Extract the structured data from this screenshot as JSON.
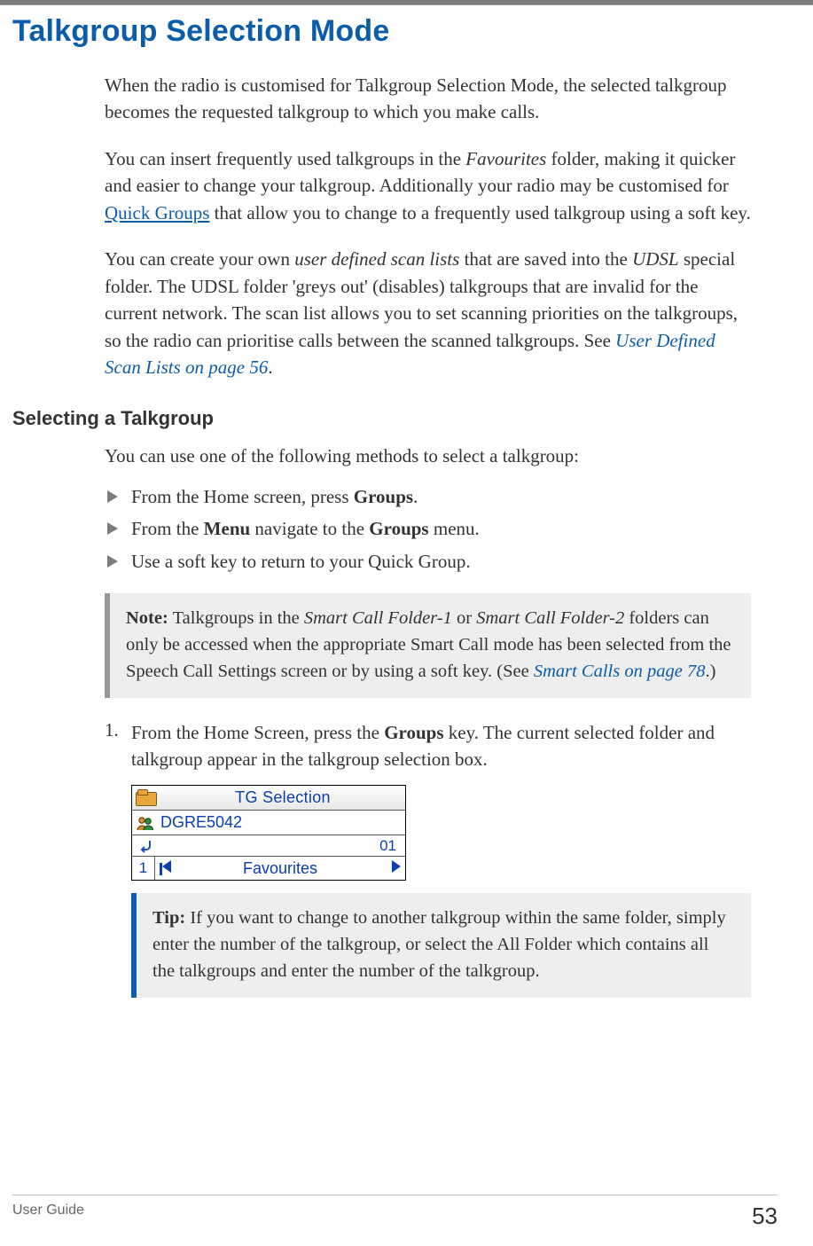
{
  "heading": "Talkgroup Selection Mode",
  "para1": "When the radio is customised for Talkgroup Selection Mode, the selected talkgroup becomes the requested talkgroup to which you make calls.",
  "para2": {
    "pre": "You can insert frequently used talkgroups in the ",
    "fav_em": "Favourites",
    "mid1": " folder, making it quicker and easier to change your talkgroup. Additionally your radio may be customised for ",
    "link_qg": "Quick Groups",
    "post": " that allow you to change to a frequently used talkgroup using a soft key."
  },
  "para3": {
    "pre": "You can create your own ",
    "em1": "user defined scan lists",
    "mid1": " that are saved into the ",
    "em2": "UDSL",
    "mid2": " special folder. The UDSL folder 'greys out' (disables) talkgroups that are invalid for the current network. The scan list allows you to set scanning priorities on the talkgroups, so the radio can prioritise calls between the scanned talkgroups. See ",
    "xref_em": "User Defined Scan Lists",
    "xref_tail": " on page 56",
    "end": "."
  },
  "subhead": "Selecting a Talkgroup",
  "para4": "You can use one of the following methods to select a talkgroup:",
  "bullets": {
    "b1": {
      "pre": "From the Home screen, press ",
      "bold": "Groups",
      "post": "."
    },
    "b2": {
      "pre": "From the ",
      "bold1": "Menu",
      "mid": " navigate to the ",
      "bold2": "Groups",
      "post": " menu."
    },
    "b3": {
      "text": "Use a soft key to return to your Quick Group."
    }
  },
  "note": {
    "label": "Note:",
    "pre": "  Talkgroups in the ",
    "em1": "Smart Call Folder-1",
    "mid1": " or ",
    "em2": "Smart Call Folder-2",
    "mid2": " folders can only be accessed when the appropriate Smart Call mode has been selected from the Speech Call Settings screen or by using a soft key. (See ",
    "xref_em": "Smart Calls",
    "xref_tail": " on page 78",
    "end": ".)"
  },
  "step1": {
    "num": "1.",
    "pre": "From the Home Screen, press the ",
    "bold": "Groups",
    "post": " key. The current selected folder and talkgroup appear in the talkgroup selection box."
  },
  "screen": {
    "title": "TG Selection",
    "tg_name": "DGRE5042",
    "count": "01",
    "index": "1",
    "folder": "Favourites"
  },
  "tip": {
    "label": "Tip:",
    "text": "  If you want to change to another talkgroup within the same folder, simply enter the number of the talkgroup, or select the All Folder which contains all the talkgroups and enter the number of the talkgroup."
  },
  "footer": {
    "left": "User Guide",
    "page": "53"
  }
}
